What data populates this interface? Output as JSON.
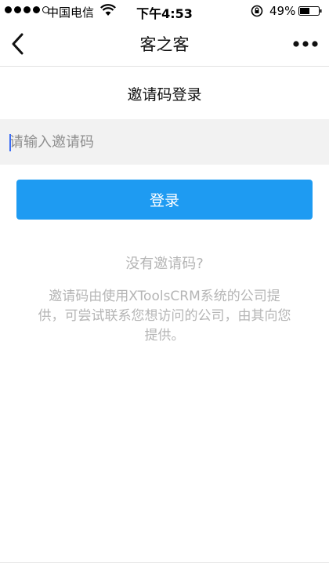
{
  "status_bar": {
    "carrier": "中国电信",
    "time": "下午4:53",
    "battery": "49%"
  },
  "navbar": {
    "title": "客之客"
  },
  "main": {
    "heading": "邀请码登录",
    "code_input_placeholder": "请输入邀请码",
    "code_input_value": "",
    "login_button": "登录",
    "help_title": "没有邀请码?",
    "help_desc": "邀请码由使用XToolsCRM系统的公司提供，可尝试联系您想访问的公司，由其向您提供。"
  },
  "colors": {
    "accent": "#1e9bf2",
    "input_bg": "#f2f2f2",
    "muted_text": "#b5b5b5"
  },
  "icons": [
    "back-chevron-icon",
    "more-dots-icon",
    "wifi-icon",
    "rotation-lock-icon",
    "battery-icon",
    "signal-dots-icon"
  ]
}
